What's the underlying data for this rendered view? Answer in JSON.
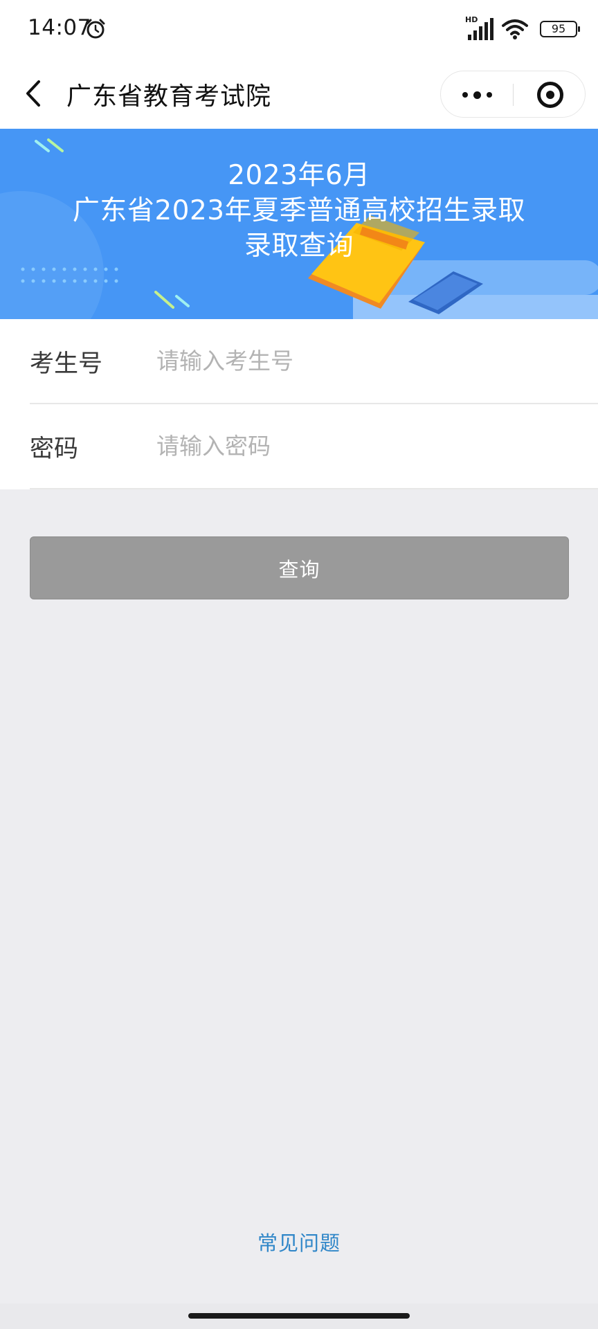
{
  "status_bar": {
    "time": "14:07",
    "network_label": "HD",
    "battery": "95"
  },
  "nav": {
    "title": "广东省教育考试院"
  },
  "banner": {
    "line1": "2023年6月",
    "line2": "广东省2023年夏季普通高校招生录取",
    "line3": "录取查询"
  },
  "form": {
    "candidate_label": "考生号",
    "candidate_placeholder": "请输入考生号",
    "password_label": "密码",
    "password_placeholder": "请输入密码"
  },
  "actions": {
    "query_label": "查询"
  },
  "footer": {
    "faq_label": "常见问题"
  },
  "colors": {
    "banner_blue": "#4696f5",
    "button_gray": "#9a9a9a",
    "link_blue": "#2f86c8",
    "page_background": "#ededf0"
  }
}
